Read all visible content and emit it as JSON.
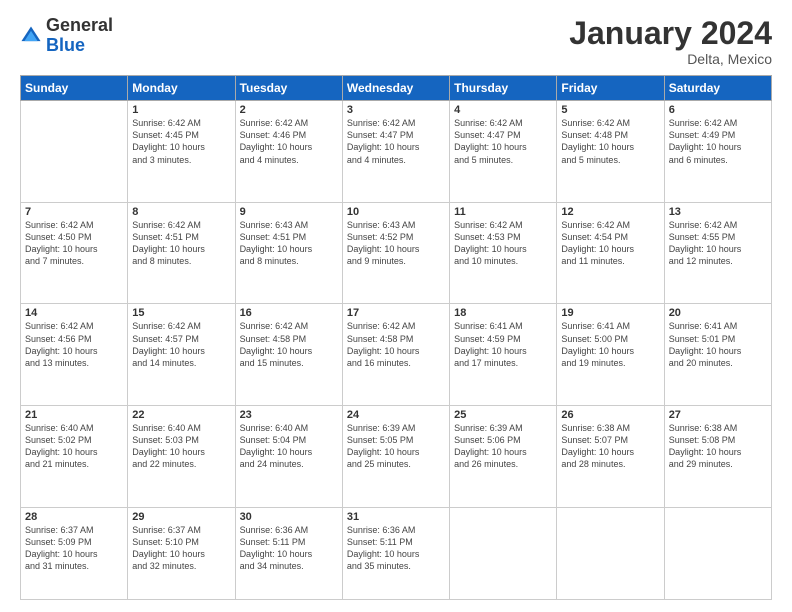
{
  "header": {
    "logo": {
      "general": "General",
      "blue": "Blue"
    },
    "title": "January 2024",
    "location": "Delta, Mexico"
  },
  "days_of_week": [
    "Sunday",
    "Monday",
    "Tuesday",
    "Wednesday",
    "Thursday",
    "Friday",
    "Saturday"
  ],
  "weeks": [
    [
      {
        "day": "",
        "info": ""
      },
      {
        "day": "1",
        "info": "Sunrise: 6:42 AM\nSunset: 4:45 PM\nDaylight: 10 hours\nand 3 minutes."
      },
      {
        "day": "2",
        "info": "Sunrise: 6:42 AM\nSunset: 4:46 PM\nDaylight: 10 hours\nand 4 minutes."
      },
      {
        "day": "3",
        "info": "Sunrise: 6:42 AM\nSunset: 4:47 PM\nDaylight: 10 hours\nand 4 minutes."
      },
      {
        "day": "4",
        "info": "Sunrise: 6:42 AM\nSunset: 4:47 PM\nDaylight: 10 hours\nand 5 minutes."
      },
      {
        "day": "5",
        "info": "Sunrise: 6:42 AM\nSunset: 4:48 PM\nDaylight: 10 hours\nand 5 minutes."
      },
      {
        "day": "6",
        "info": "Sunrise: 6:42 AM\nSunset: 4:49 PM\nDaylight: 10 hours\nand 6 minutes."
      }
    ],
    [
      {
        "day": "7",
        "info": "Sunrise: 6:42 AM\nSunset: 4:50 PM\nDaylight: 10 hours\nand 7 minutes."
      },
      {
        "day": "8",
        "info": "Sunrise: 6:42 AM\nSunset: 4:51 PM\nDaylight: 10 hours\nand 8 minutes."
      },
      {
        "day": "9",
        "info": "Sunrise: 6:43 AM\nSunset: 4:51 PM\nDaylight: 10 hours\nand 8 minutes."
      },
      {
        "day": "10",
        "info": "Sunrise: 6:43 AM\nSunset: 4:52 PM\nDaylight: 10 hours\nand 9 minutes."
      },
      {
        "day": "11",
        "info": "Sunrise: 6:42 AM\nSunset: 4:53 PM\nDaylight: 10 hours\nand 10 minutes."
      },
      {
        "day": "12",
        "info": "Sunrise: 6:42 AM\nSunset: 4:54 PM\nDaylight: 10 hours\nand 11 minutes."
      },
      {
        "day": "13",
        "info": "Sunrise: 6:42 AM\nSunset: 4:55 PM\nDaylight: 10 hours\nand 12 minutes."
      }
    ],
    [
      {
        "day": "14",
        "info": "Sunrise: 6:42 AM\nSunset: 4:56 PM\nDaylight: 10 hours\nand 13 minutes."
      },
      {
        "day": "15",
        "info": "Sunrise: 6:42 AM\nSunset: 4:57 PM\nDaylight: 10 hours\nand 14 minutes."
      },
      {
        "day": "16",
        "info": "Sunrise: 6:42 AM\nSunset: 4:58 PM\nDaylight: 10 hours\nand 15 minutes."
      },
      {
        "day": "17",
        "info": "Sunrise: 6:42 AM\nSunset: 4:58 PM\nDaylight: 10 hours\nand 16 minutes."
      },
      {
        "day": "18",
        "info": "Sunrise: 6:41 AM\nSunset: 4:59 PM\nDaylight: 10 hours\nand 17 minutes."
      },
      {
        "day": "19",
        "info": "Sunrise: 6:41 AM\nSunset: 5:00 PM\nDaylight: 10 hours\nand 19 minutes."
      },
      {
        "day": "20",
        "info": "Sunrise: 6:41 AM\nSunset: 5:01 PM\nDaylight: 10 hours\nand 20 minutes."
      }
    ],
    [
      {
        "day": "21",
        "info": "Sunrise: 6:40 AM\nSunset: 5:02 PM\nDaylight: 10 hours\nand 21 minutes."
      },
      {
        "day": "22",
        "info": "Sunrise: 6:40 AM\nSunset: 5:03 PM\nDaylight: 10 hours\nand 22 minutes."
      },
      {
        "day": "23",
        "info": "Sunrise: 6:40 AM\nSunset: 5:04 PM\nDaylight: 10 hours\nand 24 minutes."
      },
      {
        "day": "24",
        "info": "Sunrise: 6:39 AM\nSunset: 5:05 PM\nDaylight: 10 hours\nand 25 minutes."
      },
      {
        "day": "25",
        "info": "Sunrise: 6:39 AM\nSunset: 5:06 PM\nDaylight: 10 hours\nand 26 minutes."
      },
      {
        "day": "26",
        "info": "Sunrise: 6:38 AM\nSunset: 5:07 PM\nDaylight: 10 hours\nand 28 minutes."
      },
      {
        "day": "27",
        "info": "Sunrise: 6:38 AM\nSunset: 5:08 PM\nDaylight: 10 hours\nand 29 minutes."
      }
    ],
    [
      {
        "day": "28",
        "info": "Sunrise: 6:37 AM\nSunset: 5:09 PM\nDaylight: 10 hours\nand 31 minutes."
      },
      {
        "day": "29",
        "info": "Sunrise: 6:37 AM\nSunset: 5:10 PM\nDaylight: 10 hours\nand 32 minutes."
      },
      {
        "day": "30",
        "info": "Sunrise: 6:36 AM\nSunset: 5:11 PM\nDaylight: 10 hours\nand 34 minutes."
      },
      {
        "day": "31",
        "info": "Sunrise: 6:36 AM\nSunset: 5:11 PM\nDaylight: 10 hours\nand 35 minutes."
      },
      {
        "day": "",
        "info": ""
      },
      {
        "day": "",
        "info": ""
      },
      {
        "day": "",
        "info": ""
      }
    ]
  ]
}
